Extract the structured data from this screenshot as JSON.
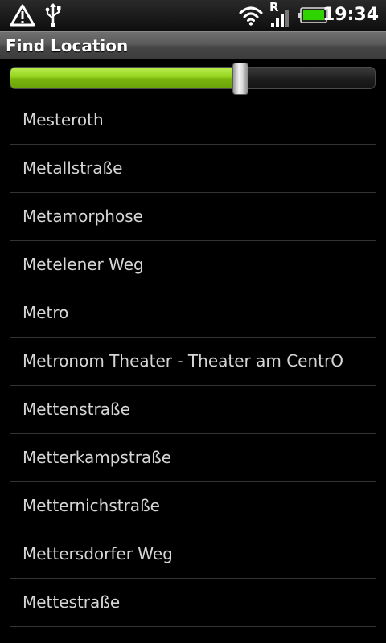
{
  "status_bar": {
    "time": "19:34",
    "network_type": "R",
    "icons": [
      "warning-icon",
      "usb-icon",
      "wifi-icon",
      "signal-icon",
      "battery-icon"
    ],
    "battery_color": "#2fd400"
  },
  "title_bar": {
    "title": "Find Location"
  },
  "slider": {
    "value_fraction": 0.63,
    "fill_color": "#96d21e"
  },
  "locations": [
    "Mesteroth",
    "Metallstraße",
    "Metamorphose",
    "Metelener Weg",
    "Metro",
    "Metronom Theater - Theater am CentrO",
    "Mettenstraße",
    "Metterkampstraße",
    "Metternichstraße",
    "Mettersdorfer Weg",
    "Mettestraße"
  ]
}
